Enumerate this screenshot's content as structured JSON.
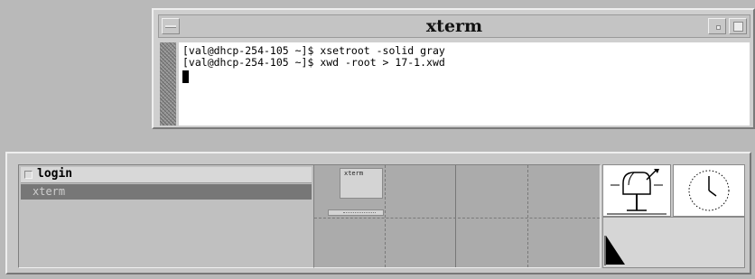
{
  "xterm": {
    "title": "xterm",
    "lines": [
      "[val@dhcp-254-105 ~]$ xsetroot -solid gray",
      "[val@dhcp-254-105 ~]$ xwd -root > 17-1.xwd"
    ]
  },
  "window_list": {
    "title": "login",
    "items": [
      "xterm"
    ]
  },
  "pager": {
    "window_label": "xterm"
  },
  "icons": {
    "mailbox": "mailbox-icon",
    "clock": "clock-icon",
    "load": "load-meter-icon"
  },
  "colors": {
    "root_background": "#b9b9b9",
    "selected_item": "#777777"
  }
}
